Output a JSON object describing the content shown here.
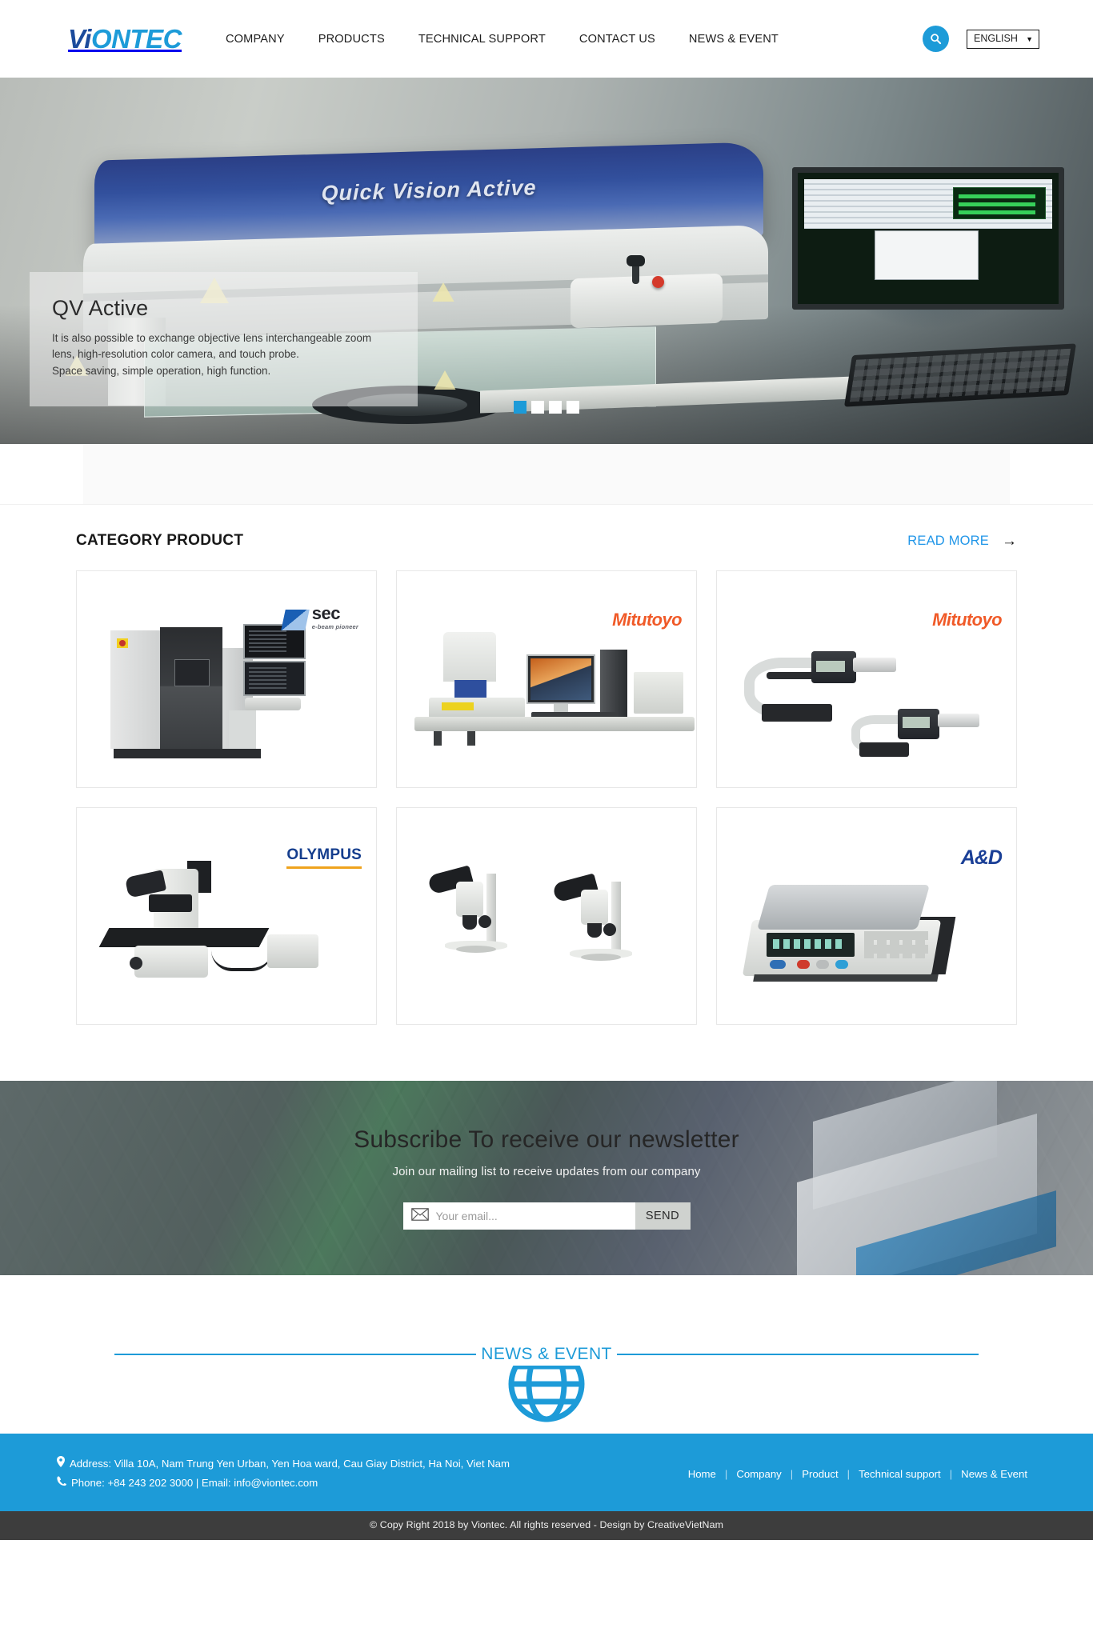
{
  "header": {
    "logo": {
      "dark": "Vi",
      "light": "ONTEC"
    },
    "nav": [
      {
        "label": "COMPANY"
      },
      {
        "label": "PRODUCTS"
      },
      {
        "label": "TECHNICAL SUPPORT"
      },
      {
        "label": "CONTACT US"
      },
      {
        "label": "NEWS & EVENT"
      }
    ],
    "search_icon": "search-icon",
    "language": {
      "selected": "ENGLISH",
      "options": [
        "ENGLISH"
      ],
      "caret_icon": "chevron-down-icon"
    }
  },
  "hero": {
    "machine_label": "Quick Vision Active",
    "title": "QV Active",
    "description": "It is also possible to exchange objective lens interchangeable zoom lens, high-resolution color camera, and touch probe.\nSpace saving, simple operation, high function.",
    "description_lines": [
      "It is also possible to exchange objective lens interchangeable zoom",
      "lens, high-resolution color camera, and touch probe.",
      "Space saving, simple operation, high function."
    ],
    "slides_total": 4,
    "active_slide": 1,
    "accent_color": "#1d9bd8"
  },
  "products": {
    "section_title": "CATEGORY PRODUCT",
    "read_more": "READ MORE",
    "read_more_arrow": "arrow-right-icon",
    "items": [
      {
        "id": "xray-inspection",
        "brand": "sec",
        "brand_tagline": "e-beam pioneer",
        "brand_color": "#1a5fb4",
        "alt": "X-ray inspection system"
      },
      {
        "id": "vision-measuring-system",
        "brand": "Mitutoyo",
        "brand_color": "#f05a28",
        "alt": "Vision measuring system with PC workstation"
      },
      {
        "id": "micrometers",
        "brand": "Mitutoyo",
        "brand_color": "#f05a28",
        "alt": "Digital micrometers"
      },
      {
        "id": "metallurgical-microscope",
        "brand": "OLYMPUS",
        "brand_color": "#143d8d",
        "alt": "Metallurgical microscope"
      },
      {
        "id": "stereo-microscopes",
        "brand": "",
        "brand_color": "",
        "alt": "Stereo microscopes"
      },
      {
        "id": "counting-scale",
        "brand": "A&D",
        "brand_color": "#1a3f96",
        "alt": "Electronic counting scale"
      }
    ]
  },
  "newsletter": {
    "title": "Subscribe To receive our newsletter",
    "subtitle": "Join our mailing list to receive updates from our company",
    "email_placeholder": "Your email...",
    "email_value": "",
    "email_icon": "envelope-icon",
    "send_label": "SEND"
  },
  "news_divider": {
    "label": "NEWS & EVENT",
    "icon": "globe-icon",
    "color": "#1d9bd8"
  },
  "footer": {
    "address_icon": "map-pin-icon",
    "address": "Address: Villa 10A, Nam Trung Yen Urban, Yen Hoa ward, Cau Giay District, Ha Noi, Viet Nam",
    "phone_icon": "phone-icon",
    "phone_email": "Phone: +84 243 202 3000 | Email: info@viontec.com",
    "links": [
      {
        "label": "Home"
      },
      {
        "label": "Company"
      },
      {
        "label": "Product"
      },
      {
        "label": "Technical support"
      },
      {
        "label": "News & Event"
      }
    ],
    "background_color": "#1d9bd8",
    "copyright": "© Copy Right 2018 by Viontec. All rights reserved - Design by CreativeVietNam"
  }
}
